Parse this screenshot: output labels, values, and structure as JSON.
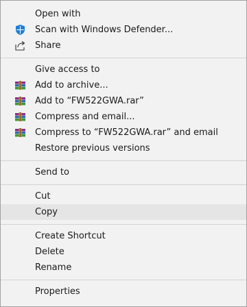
{
  "menu": {
    "open_with": "Open with",
    "scan_defender": "Scan with Windows Defender...",
    "share": "Share",
    "give_access": "Give access to",
    "add_archive": "Add to archive...",
    "add_rar": "Add to “FW522GWA.rar”",
    "compress_email": "Compress and email...",
    "compress_rar_email": "Compress to “FW522GWA.rar” and email",
    "restore_versions": "Restore previous versions",
    "send_to": "Send to",
    "cut": "Cut",
    "copy": "Copy",
    "create_shortcut": "Create Shortcut",
    "delete": "Delete",
    "rename": "Rename",
    "properties": "Properties"
  },
  "icons": {
    "defender": "windows-defender-shield-icon",
    "share": "share-icon",
    "winrar": "winrar-books-icon"
  },
  "colors": {
    "menu_bg": "#f2f2f2",
    "highlight": "#e5e5e5",
    "separator": "#d2d2d2",
    "text": "#1a1a1a",
    "defender_blue": "#1e7fd6"
  }
}
